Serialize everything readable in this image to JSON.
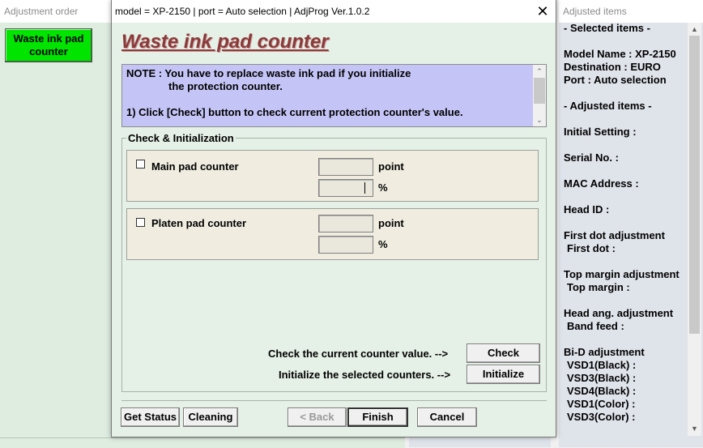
{
  "left_window": {
    "title": "Adjustment order",
    "waste_button": "Waste ink pad counter"
  },
  "right_window": {
    "title": "Adjusted items",
    "lines": [
      "- Selected items -",
      "Model Name : XP-2150",
      "Destination : EURO",
      "Port : Auto selection",
      "- Adjusted items -",
      "Initial Setting :",
      "Serial No. :",
      "MAC Address :",
      "Head ID :",
      "First dot adjustment",
      " First dot :",
      "Top margin adjustment",
      " Top margin :",
      "Head ang. adjustment",
      " Band feed :",
      "Bi-D adjustment",
      " VSD1(Black) :",
      " VSD3(Black) :",
      " VSD4(Black) :",
      " VSD1(Color) :",
      " VSD3(Color) :"
    ]
  },
  "dialog": {
    "title": "model = XP-2150 | port = Auto selection | AdjProg Ver.1.0.2",
    "close_glyph": "✕",
    "heading": "Waste ink pad counter",
    "note": {
      "line1": "NOTE : You have to replace waste ink pad if you initialize",
      "line2": "the protection counter.",
      "line3": "1) Click [Check] button to check current protection counter's value."
    },
    "group_label": "Check & Initialization",
    "counters": [
      {
        "label": "Main pad counter",
        "unit_point": "point",
        "unit_percent": "%",
        "point_value": "",
        "percent_value": ""
      },
      {
        "label": "Platen pad counter",
        "unit_point": "point",
        "unit_percent": "%",
        "point_value": "",
        "percent_value": ""
      }
    ],
    "check_text": "Check the current counter value. -->",
    "check_button": "Check",
    "init_text": "Initialize the selected counters. -->",
    "init_button": "Initialize",
    "buttons": {
      "get_status": "Get Status",
      "cleaning": "Cleaning",
      "back": "< Back",
      "finish": "Finish",
      "cancel": "Cancel"
    }
  },
  "colors": {
    "heading": "#8b3a3a",
    "note_bg": "#c4c4f6",
    "dialog_bg": "#e5f0e6",
    "waste_button_bg": "#00e400"
  }
}
